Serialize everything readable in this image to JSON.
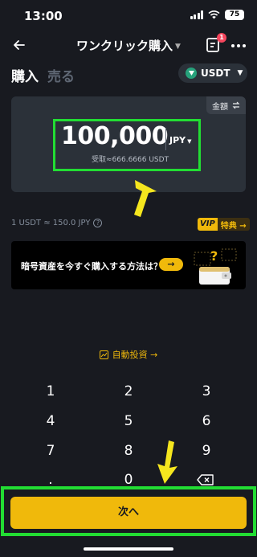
{
  "status_bar": {
    "time": "13:00",
    "battery": "75"
  },
  "header": {
    "title": "ワンクリック購入",
    "order_badge_count": "1",
    "icons": [
      "back-arrow-icon",
      "order-list-icon",
      "more-icon"
    ]
  },
  "tabs": [
    {
      "label": "購入",
      "active": true
    },
    {
      "label": "売る",
      "active": false
    }
  ],
  "crypto_select": {
    "value": "USDT",
    "icon": "tether-icon"
  },
  "amount_card": {
    "mode_label": "金額",
    "amount": "100,000",
    "fiat": "JPY",
    "receive_label": "受取≈666.6666 USDT"
  },
  "rate": {
    "text": "1 USDT ≈ 150.0 JPY"
  },
  "vip": {
    "vip_label": "VIP",
    "perk_label": "特典 →"
  },
  "promo": {
    "text": "暗号資産を今すぐ購入する方法は？",
    "button_icon": "→"
  },
  "auto_invest": {
    "label": "自動投資 →"
  },
  "keypad": {
    "keys": [
      "1",
      "2",
      "3",
      "4",
      "5",
      "6",
      "7",
      "8",
      "9",
      ".",
      "0"
    ],
    "backspace_icon": "backspace-icon"
  },
  "next_button": {
    "label": "次へ"
  },
  "colors": {
    "background": "#181a20",
    "accent": "#f0b90b",
    "highlight": "#22dd33",
    "card": "#2b3139"
  }
}
